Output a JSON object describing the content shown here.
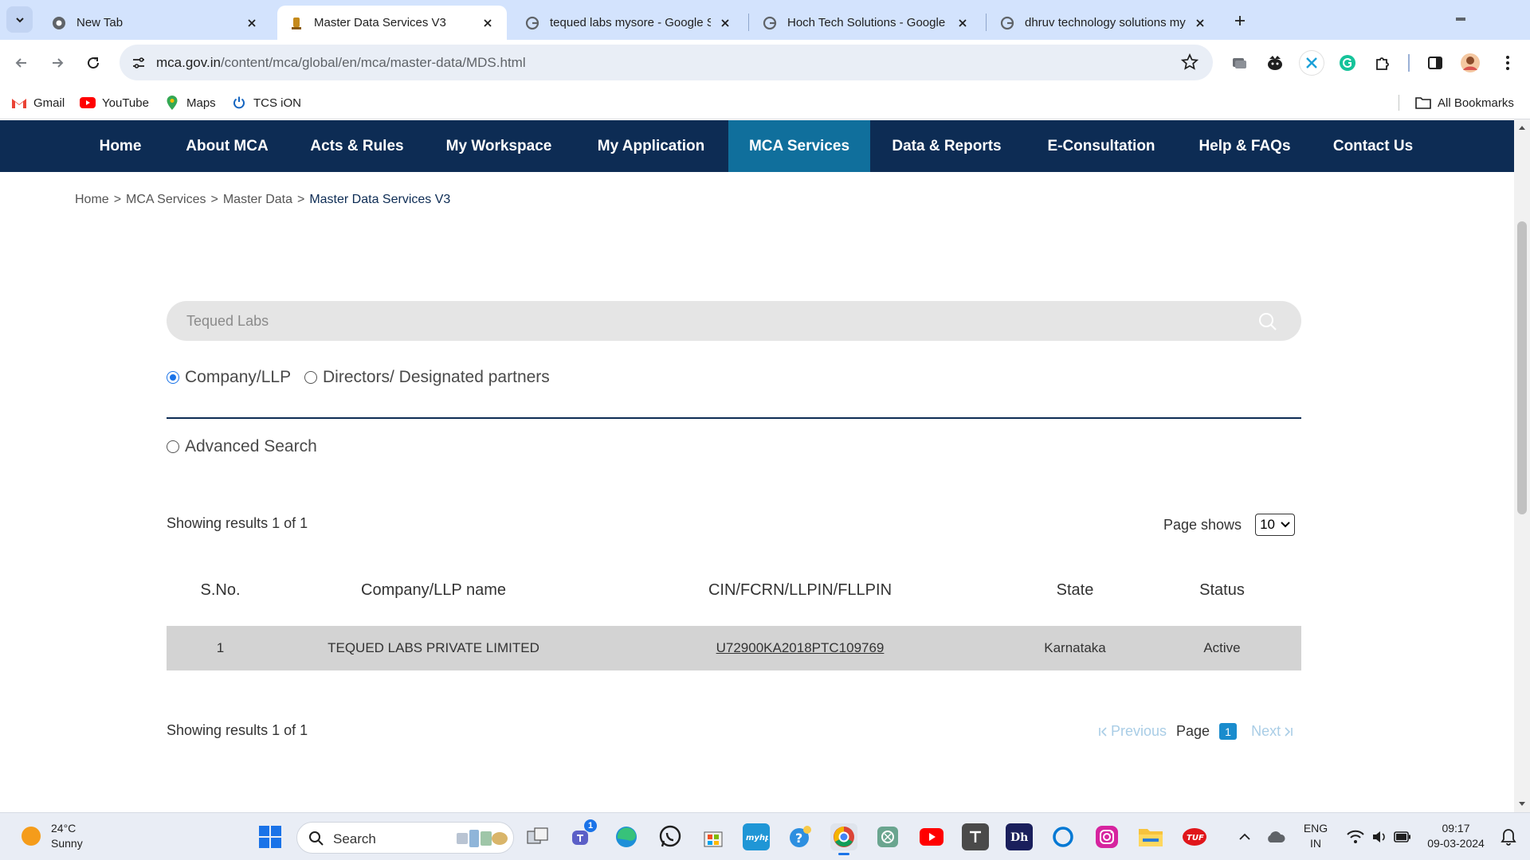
{
  "browser": {
    "tabs": [
      {
        "title": "New Tab",
        "active": false
      },
      {
        "title": "Master Data Services V3",
        "active": true
      },
      {
        "title": "tequed labs mysore - Google Se",
        "active": false
      },
      {
        "title": "Hoch Tech Solutions - Google S",
        "active": false
      },
      {
        "title": "dhruv technology solutions mys",
        "active": false
      }
    ],
    "url_host": "mca.gov.in",
    "url_path": "/content/mca/global/en/mca/master-data/MDS.html",
    "bookmarks": [
      "Gmail",
      "YouTube",
      "Maps",
      "TCS iON"
    ],
    "all_bookmarks": "All Bookmarks"
  },
  "nav": {
    "items": [
      "Home",
      "About MCA",
      "Acts & Rules",
      "My Workspace",
      "My Application",
      "MCA Services",
      "Data & Reports",
      "E-Consultation",
      "Help & FAQs",
      "Contact Us"
    ],
    "active": "MCA Services"
  },
  "breadcrumb": {
    "items": [
      "Home",
      "MCA Services",
      "Master Data"
    ],
    "separator": ">",
    "current": "Master Data Services V3"
  },
  "search": {
    "value": "Tequed Labs"
  },
  "filters": {
    "company_llp": "Company/LLP",
    "directors": "Directors/ Designated partners",
    "advanced": "Advanced Search",
    "selected": "Company/LLP"
  },
  "results": {
    "showing_top": "Showing results 1 of 1",
    "showing_bottom": "Showing results 1 of 1",
    "page_shows_label": "Page shows",
    "page_shows_value": "10",
    "columns": [
      "S.No.",
      "Company/LLP name",
      "CIN/FCRN/LLPIN/FLLPIN",
      "State",
      "Status"
    ],
    "rows": [
      {
        "sno": "1",
        "name": "TEQUED LABS PRIVATE LIMITED",
        "cin": "U72900KA2018PTC109769",
        "state": "Karnataka",
        "status": "Active"
      }
    ]
  },
  "pagination": {
    "previous": "Previous",
    "page_label": "Page",
    "current_page": "1",
    "next": "Next"
  },
  "taskbar": {
    "weather_temp": "24°C",
    "weather_desc": "Sunny",
    "search_label": "Search",
    "lang_top": "ENG",
    "lang_bottom": "IN",
    "time": "09:17",
    "date": "09-03-2024",
    "teams_badge": "1"
  },
  "colors": {
    "nav_bg": "#0d2c54",
    "nav_active": "#106f9c",
    "link_blue": "#1a8ccd",
    "tab_strip": "#d3e3fd"
  }
}
